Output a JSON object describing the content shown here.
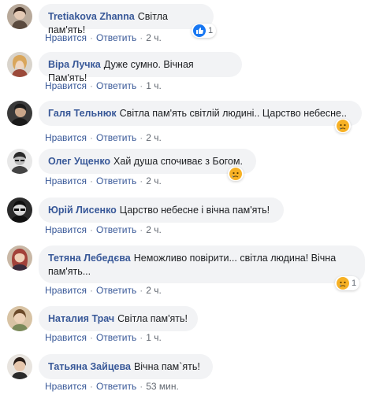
{
  "comments": [
    {
      "author": "Tretiakova Zhanna",
      "text": "Світла пам'ять!",
      "like": "Нравится",
      "reply": "Ответить",
      "time": "2 ч.",
      "reaction": {
        "icon": "like-icon",
        "count": "1"
      }
    },
    {
      "author": "Віра Лучка",
      "text": "Дуже сумно. Вічная Пам'ять!",
      "like": "Нравится",
      "reply": "Ответить",
      "time": "1 ч."
    },
    {
      "author": "Галя Тельнюк",
      "text": "Світла пам'ять світлій людині.. Царство небесне..",
      "like": "Нравится",
      "reply": "Ответить",
      "time": "2 ч.",
      "reaction": {
        "icon": "sad-icon",
        "count": ""
      }
    },
    {
      "author": "Олег Ущенко",
      "text": "Хай душа спочиває з Богом.",
      "like": "Нравится",
      "reply": "Ответить",
      "time": "2 ч.",
      "reaction": {
        "icon": "sad-icon",
        "count": ""
      }
    },
    {
      "author": "Юрій Лисенко",
      "text": "Царство небесне і вічна пам'ять!",
      "like": "Нравится",
      "reply": "Ответить",
      "time": "2 ч."
    },
    {
      "author": "Тетяна Лебедєва",
      "text": "Неможливо повірити... світла людина! Вічна пам'ять...",
      "like": "Нравится",
      "reply": "Ответить",
      "time": "2 ч.",
      "reaction": {
        "icon": "sad-icon",
        "count": "1"
      }
    },
    {
      "author": "Наталия Трач",
      "text": "Світла пам'ять!",
      "like": "Нравится",
      "reply": "Ответить",
      "time": "1 ч."
    },
    {
      "author": "Татьяна Зайцева",
      "text": "Вічна пам`ять!",
      "like": "Нравится",
      "reply": "Ответить",
      "time": "53 мин."
    }
  ],
  "colors": {
    "link": "#385898",
    "bubble": "#f2f3f5",
    "meta": "#616770",
    "like_blue": "#1877f2",
    "sad_yellow": "#f7b125"
  }
}
